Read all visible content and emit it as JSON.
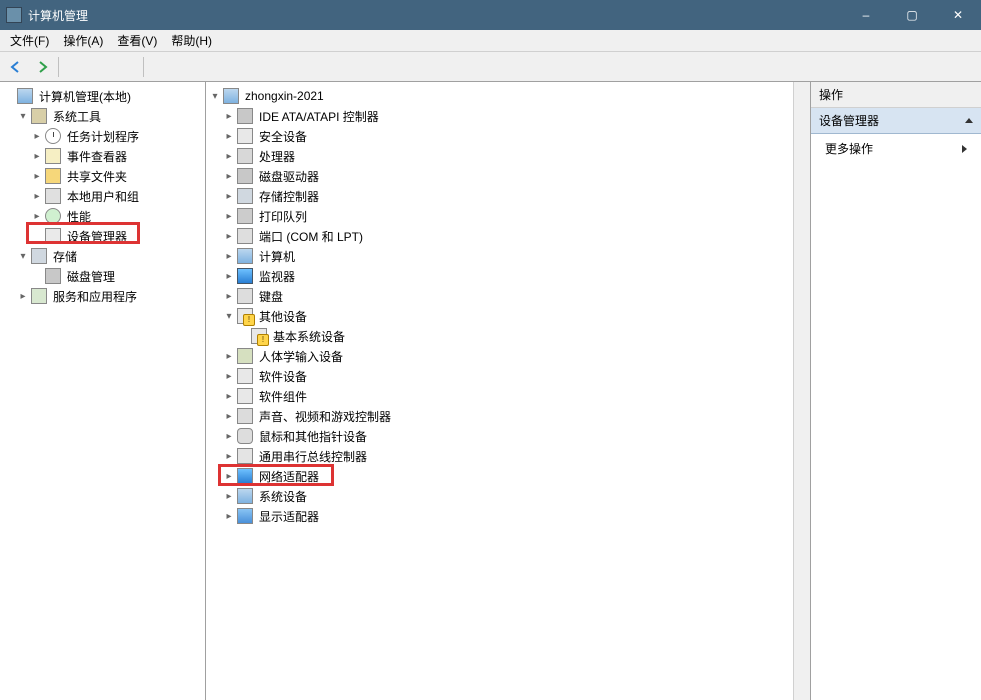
{
  "window": {
    "title": "计算机管理",
    "min": "–",
    "max": "▢",
    "close": "✕"
  },
  "menu": {
    "file": "文件(F)",
    "action": "操作(A)",
    "view": "查看(V)",
    "help": "帮助(H)"
  },
  "toolbar": {
    "back_icon": "back-arrow-icon",
    "fwd_icon": "forward-arrow-icon",
    "up_icon": "up-folder-icon",
    "props_icon": "properties-icon",
    "list_icon": "list-view-icon",
    "help_icon": "help-icon"
  },
  "left_tree": {
    "root": "计算机管理(本地)",
    "system_tools": "系统工具",
    "task_scheduler": "任务计划程序",
    "event_viewer": "事件查看器",
    "shared_folders": "共享文件夹",
    "local_users": "本地用户和组",
    "performance": "性能",
    "device_manager": "设备管理器",
    "storage": "存储",
    "disk_mgmt": "磁盘管理",
    "services_apps": "服务和应用程序"
  },
  "mid_tree": {
    "host": "zhongxin-2021",
    "ide": "IDE ATA/ATAPI 控制器",
    "security": "安全设备",
    "cpu": "处理器",
    "diskdrive": "磁盘驱动器",
    "storage_ctrl": "存储控制器",
    "print_queue": "打印队列",
    "ports": "端口 (COM 和 LPT)",
    "computer": "计算机",
    "monitor": "监视器",
    "keyboard": "键盘",
    "other": "其他设备",
    "other_child": "基本系统设备",
    "hid": "人体学输入设备",
    "soft_dev": "软件设备",
    "soft_comp": "软件组件",
    "sound": "声音、视频和游戏控制器",
    "mouse": "鼠标和其他指针设备",
    "usb_ctrl": "通用串行总线控制器",
    "network": "网络适配器",
    "system_dev": "系统设备",
    "display": "显示适配器"
  },
  "actions": {
    "header": "操作",
    "selected": "设备管理器",
    "more": "更多操作"
  }
}
